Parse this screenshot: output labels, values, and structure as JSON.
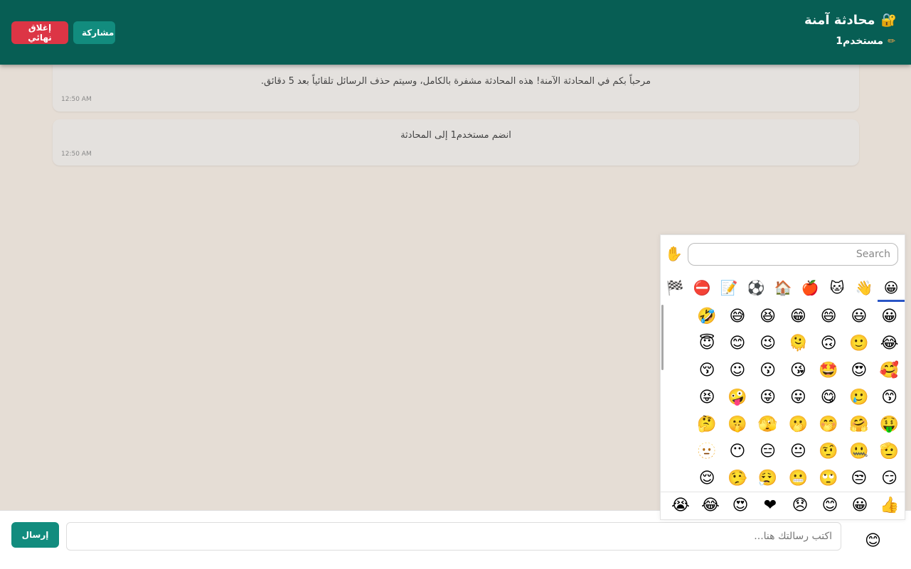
{
  "header": {
    "title": "محادثة آمنة",
    "lock_icon": "🔐",
    "user_name": "مستخدم1",
    "edit_icon": "✏",
    "share_label": "مشاركة",
    "close_label": "إغلاق نهائي"
  },
  "messages": [
    {
      "text": "مرحباً بكم في المحادثة الآمنة! هذه المحادثة مشفرة بالكامل، وسيتم حذف الرسائل تلقائياً بعد 5 دقائق.",
      "time": "12:50 AM"
    },
    {
      "text": "انضم مستخدم1 إلى المحادثة",
      "time": "12:50 AM"
    }
  ],
  "emoji_picker": {
    "skin_tone_icon": "✋",
    "search_placeholder": "Search",
    "categories": [
      "😀",
      "👋",
      "🐱",
      "🍎",
      "🏠",
      "⚽",
      "📝",
      "⛔",
      "🏁"
    ],
    "grid": [
      "😀",
      "😃",
      "😄",
      "😁",
      "😆",
      "😅",
      "🤣",
      "😂",
      "🙂",
      "🙃",
      "🫠",
      "😉",
      "😊",
      "😇",
      "🥰",
      "😍",
      "🤩",
      "😘",
      "😗",
      "☺",
      "😚",
      "😙",
      "🥲",
      "😋",
      "😛",
      "😜",
      "🤪",
      "😝",
      "🤑",
      "🤗",
      "🤭",
      "🫢",
      "🫣",
      "🤫",
      "🤔",
      "🫡",
      "🤐",
      "🤨",
      "😐",
      "😑",
      "😶",
      "🫥",
      "😏",
      "😒",
      "🙄",
      "😬",
      "😮‍💨",
      "🤥",
      "😌",
      "😔",
      "😪",
      "🤤",
      "😴",
      "😷",
      "🤒",
      "🤕"
    ],
    "recent": [
      "👍",
      "😀",
      "😊",
      "😞",
      "❤",
      "😍",
      "😂",
      "😭"
    ]
  },
  "composer": {
    "emoji_toggle_icon": "😊",
    "placeholder": "اكتب رسالتك هنا...",
    "send_label": "إرسال"
  }
}
